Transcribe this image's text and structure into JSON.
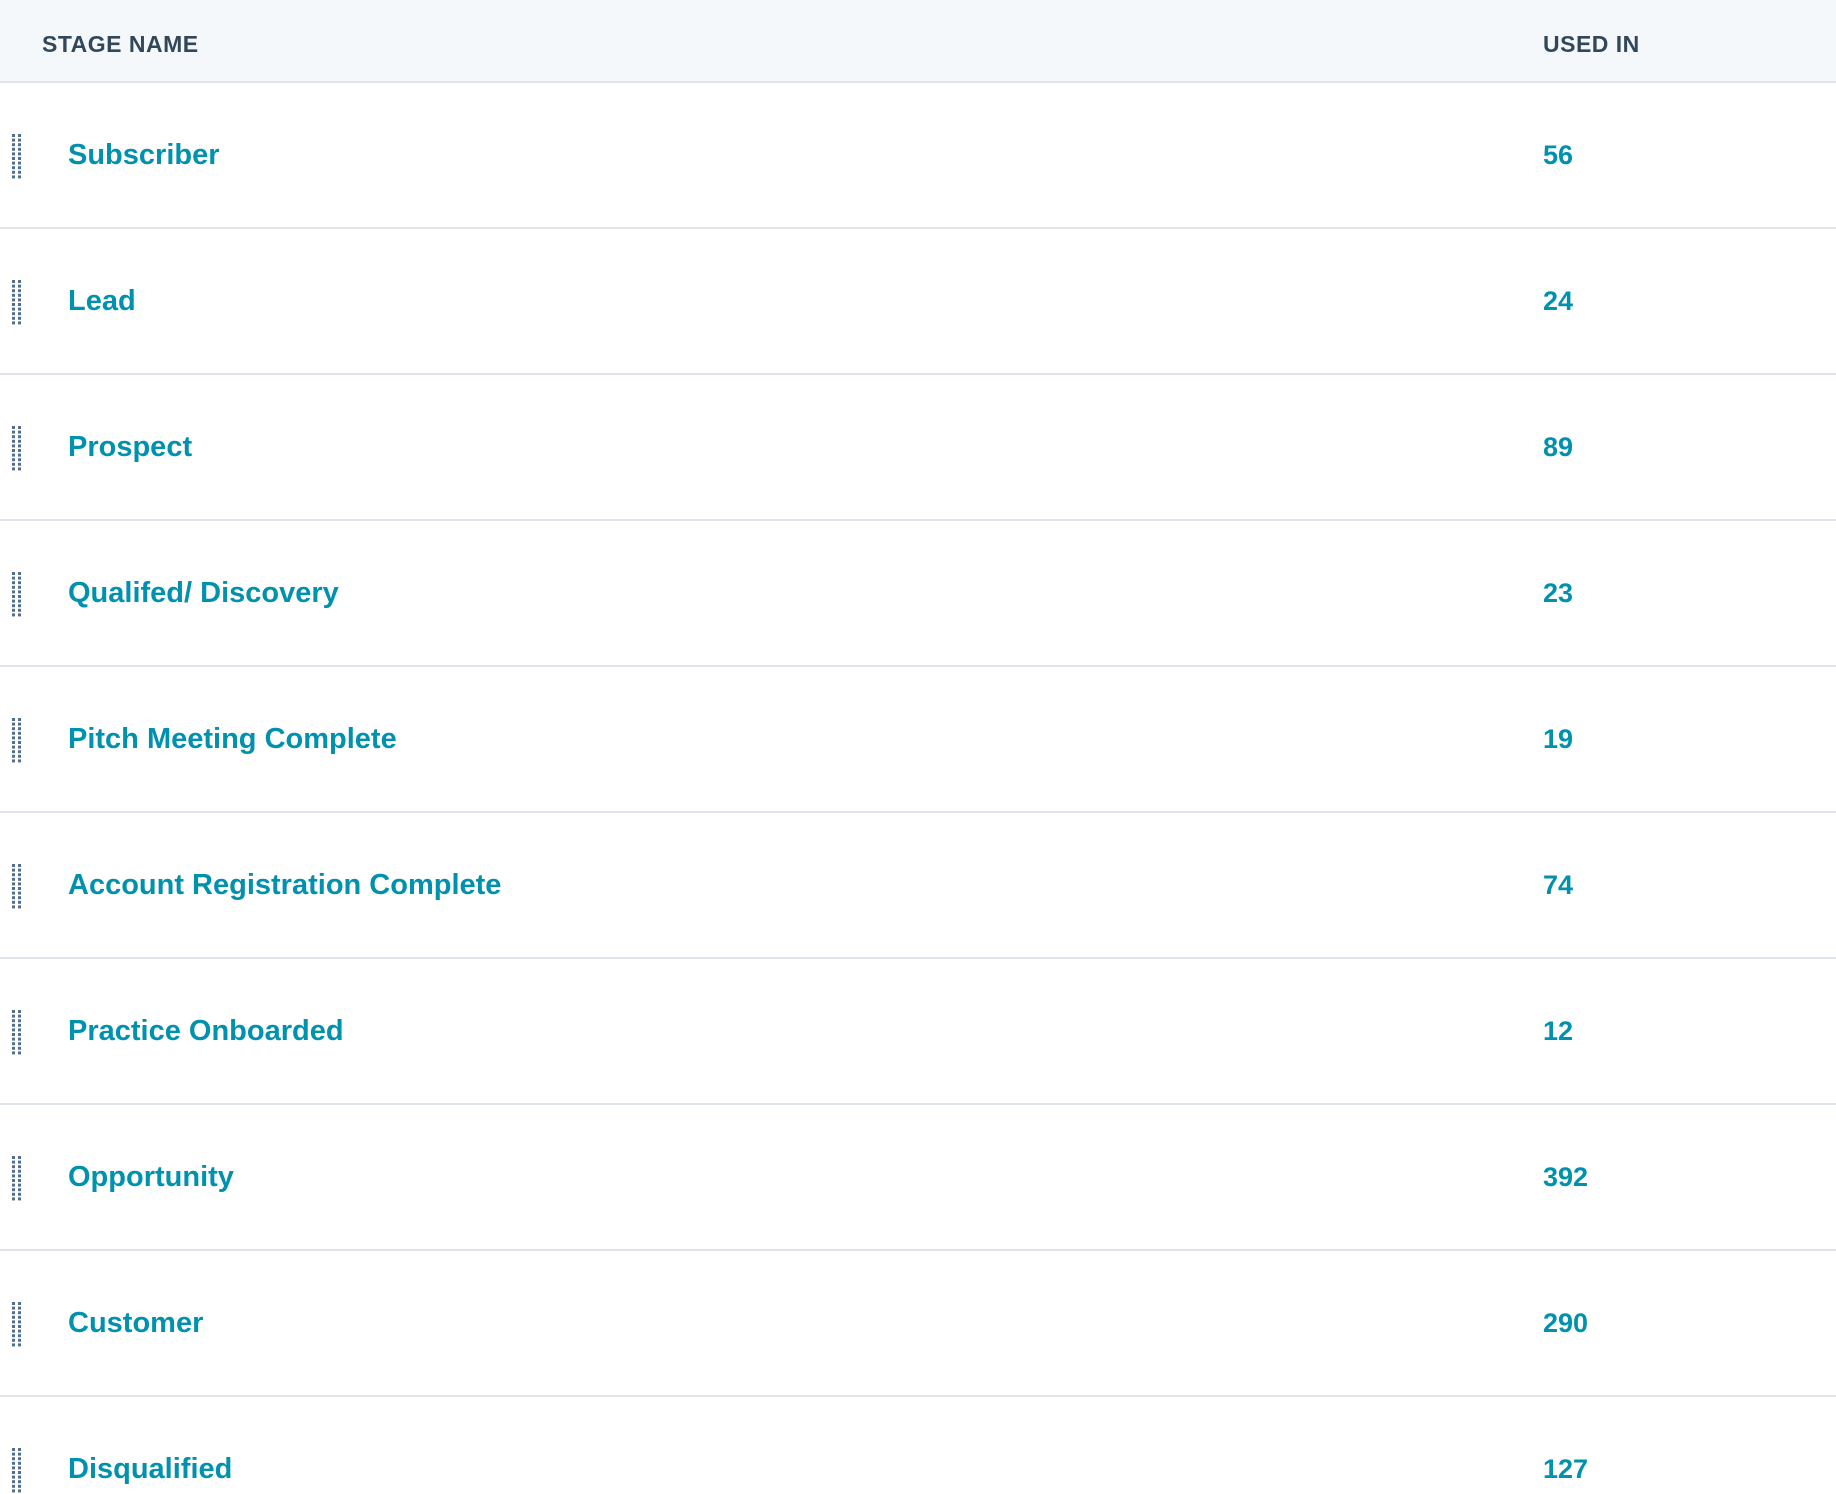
{
  "table": {
    "columns": {
      "stage_name": "STAGE NAME",
      "used_in": "USED IN"
    },
    "rows": [
      {
        "name": "Subscriber",
        "used_in": "56"
      },
      {
        "name": "Lead",
        "used_in": "24"
      },
      {
        "name": "Prospect",
        "used_in": "89"
      },
      {
        "name": "Qualifed/ Discovery",
        "used_in": "23"
      },
      {
        "name": "Pitch Meeting Complete",
        "used_in": "19"
      },
      {
        "name": "Account Registration Complete",
        "used_in": "74"
      },
      {
        "name": "Practice Onboarded",
        "used_in": "12"
      },
      {
        "name": "Opportunity",
        "used_in": "392"
      },
      {
        "name": "Customer",
        "used_in": "290"
      },
      {
        "name": "Disqualified",
        "used_in": "127"
      }
    ]
  },
  "icons": {
    "drag_handle": "drag-handle-icon"
  },
  "colors": {
    "link": "#0091ae",
    "header_text": "#33475b",
    "header_bg": "#f5f8fa",
    "divider": "#dfe3eb",
    "handle": "#516f90"
  }
}
